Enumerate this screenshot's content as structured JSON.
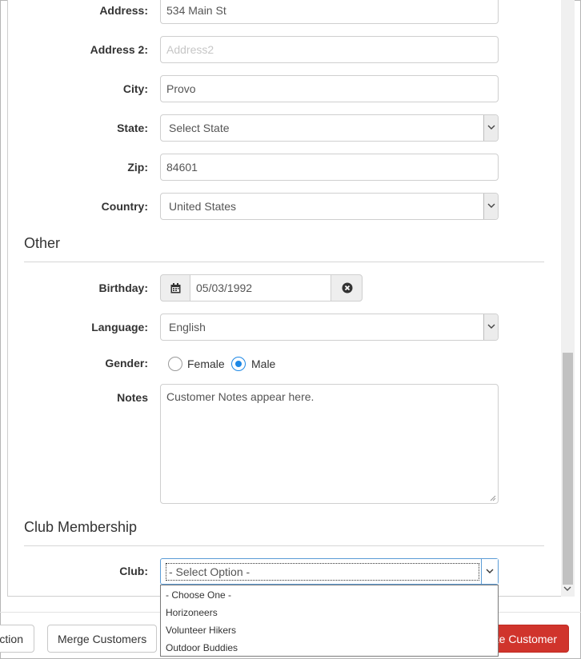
{
  "address": {
    "label": "Address:",
    "value": "534 Main St"
  },
  "address2": {
    "label": "Address 2:",
    "placeholder": "Address2"
  },
  "city": {
    "label": "City:",
    "value": "Provo"
  },
  "state": {
    "label": "State:",
    "value": "Select State"
  },
  "zip": {
    "label": "Zip:",
    "value": "84601"
  },
  "country": {
    "label": "Country:",
    "value": "United States"
  },
  "other_section": {
    "title": "Other"
  },
  "birthday": {
    "label": "Birthday:",
    "value": "05/03/1992"
  },
  "language": {
    "label": "Language:",
    "value": "English"
  },
  "gender": {
    "label": "Gender:",
    "options": [
      "Female",
      "Male"
    ],
    "selected": "Male"
  },
  "notes": {
    "label": "Notes",
    "value": "Customer Notes appear here."
  },
  "club_section": {
    "title": "Club Membership"
  },
  "club": {
    "label": "Club:",
    "value": "- Select Option -",
    "options": [
      "- Choose One -",
      "Horizoneers",
      "Volunteer Hikers",
      "Outdoor Buddies"
    ]
  },
  "footer": {
    "left_button": "ction",
    "merge_button": "Merge Customers",
    "primary_button": "te Customer"
  },
  "colors": {
    "primary": "#d0342c",
    "focus": "#1e88e5"
  },
  "icons": [
    "chevron-down-icon",
    "calendar-icon",
    "clear-circle-icon",
    "resize-grip-icon"
  ]
}
